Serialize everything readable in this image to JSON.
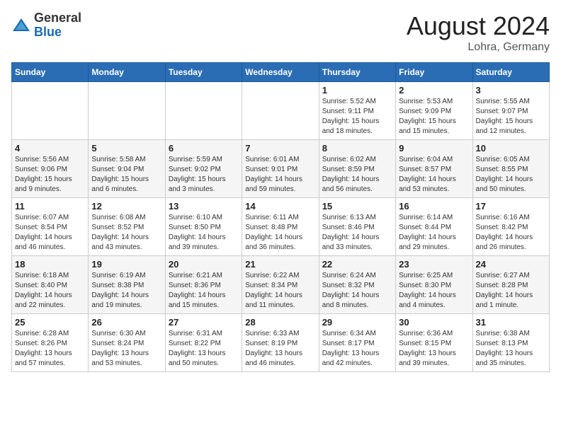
{
  "header": {
    "logo_general": "General",
    "logo_blue": "Blue",
    "month_title": "August 2024",
    "location": "Lohra, Germany"
  },
  "weekdays": [
    "Sunday",
    "Monday",
    "Tuesday",
    "Wednesday",
    "Thursday",
    "Friday",
    "Saturday"
  ],
  "weeks": [
    [
      {
        "day": "",
        "info": ""
      },
      {
        "day": "",
        "info": ""
      },
      {
        "day": "",
        "info": ""
      },
      {
        "day": "",
        "info": ""
      },
      {
        "day": "1",
        "info": "Sunrise: 5:52 AM\nSunset: 9:11 PM\nDaylight: 15 hours\nand 18 minutes."
      },
      {
        "day": "2",
        "info": "Sunrise: 5:53 AM\nSunset: 9:09 PM\nDaylight: 15 hours\nand 15 minutes."
      },
      {
        "day": "3",
        "info": "Sunrise: 5:55 AM\nSunset: 9:07 PM\nDaylight: 15 hours\nand 12 minutes."
      }
    ],
    [
      {
        "day": "4",
        "info": "Sunrise: 5:56 AM\nSunset: 9:06 PM\nDaylight: 15 hours\nand 9 minutes."
      },
      {
        "day": "5",
        "info": "Sunrise: 5:58 AM\nSunset: 9:04 PM\nDaylight: 15 hours\nand 6 minutes."
      },
      {
        "day": "6",
        "info": "Sunrise: 5:59 AM\nSunset: 9:02 PM\nDaylight: 15 hours\nand 3 minutes."
      },
      {
        "day": "7",
        "info": "Sunrise: 6:01 AM\nSunset: 9:01 PM\nDaylight: 14 hours\nand 59 minutes."
      },
      {
        "day": "8",
        "info": "Sunrise: 6:02 AM\nSunset: 8:59 PM\nDaylight: 14 hours\nand 56 minutes."
      },
      {
        "day": "9",
        "info": "Sunrise: 6:04 AM\nSunset: 8:57 PM\nDaylight: 14 hours\nand 53 minutes."
      },
      {
        "day": "10",
        "info": "Sunrise: 6:05 AM\nSunset: 8:55 PM\nDaylight: 14 hours\nand 50 minutes."
      }
    ],
    [
      {
        "day": "11",
        "info": "Sunrise: 6:07 AM\nSunset: 8:54 PM\nDaylight: 14 hours\nand 46 minutes."
      },
      {
        "day": "12",
        "info": "Sunrise: 6:08 AM\nSunset: 8:52 PM\nDaylight: 14 hours\nand 43 minutes."
      },
      {
        "day": "13",
        "info": "Sunrise: 6:10 AM\nSunset: 8:50 PM\nDaylight: 14 hours\nand 39 minutes."
      },
      {
        "day": "14",
        "info": "Sunrise: 6:11 AM\nSunset: 8:48 PM\nDaylight: 14 hours\nand 36 minutes."
      },
      {
        "day": "15",
        "info": "Sunrise: 6:13 AM\nSunset: 8:46 PM\nDaylight: 14 hours\nand 33 minutes."
      },
      {
        "day": "16",
        "info": "Sunrise: 6:14 AM\nSunset: 8:44 PM\nDaylight: 14 hours\nand 29 minutes."
      },
      {
        "day": "17",
        "info": "Sunrise: 6:16 AM\nSunset: 8:42 PM\nDaylight: 14 hours\nand 26 minutes."
      }
    ],
    [
      {
        "day": "18",
        "info": "Sunrise: 6:18 AM\nSunset: 8:40 PM\nDaylight: 14 hours\nand 22 minutes."
      },
      {
        "day": "19",
        "info": "Sunrise: 6:19 AM\nSunset: 8:38 PM\nDaylight: 14 hours\nand 19 minutes."
      },
      {
        "day": "20",
        "info": "Sunrise: 6:21 AM\nSunset: 8:36 PM\nDaylight: 14 hours\nand 15 minutes."
      },
      {
        "day": "21",
        "info": "Sunrise: 6:22 AM\nSunset: 8:34 PM\nDaylight: 14 hours\nand 11 minutes."
      },
      {
        "day": "22",
        "info": "Sunrise: 6:24 AM\nSunset: 8:32 PM\nDaylight: 14 hours\nand 8 minutes."
      },
      {
        "day": "23",
        "info": "Sunrise: 6:25 AM\nSunset: 8:30 PM\nDaylight: 14 hours\nand 4 minutes."
      },
      {
        "day": "24",
        "info": "Sunrise: 6:27 AM\nSunset: 8:28 PM\nDaylight: 14 hours\nand 1 minute."
      }
    ],
    [
      {
        "day": "25",
        "info": "Sunrise: 6:28 AM\nSunset: 8:26 PM\nDaylight: 13 hours\nand 57 minutes."
      },
      {
        "day": "26",
        "info": "Sunrise: 6:30 AM\nSunset: 8:24 PM\nDaylight: 13 hours\nand 53 minutes."
      },
      {
        "day": "27",
        "info": "Sunrise: 6:31 AM\nSunset: 8:22 PM\nDaylight: 13 hours\nand 50 minutes."
      },
      {
        "day": "28",
        "info": "Sunrise: 6:33 AM\nSunset: 8:19 PM\nDaylight: 13 hours\nand 46 minutes."
      },
      {
        "day": "29",
        "info": "Sunrise: 6:34 AM\nSunset: 8:17 PM\nDaylight: 13 hours\nand 42 minutes."
      },
      {
        "day": "30",
        "info": "Sunrise: 6:36 AM\nSunset: 8:15 PM\nDaylight: 13 hours\nand 39 minutes."
      },
      {
        "day": "31",
        "info": "Sunrise: 6:38 AM\nSunset: 8:13 PM\nDaylight: 13 hours\nand 35 minutes."
      }
    ]
  ]
}
